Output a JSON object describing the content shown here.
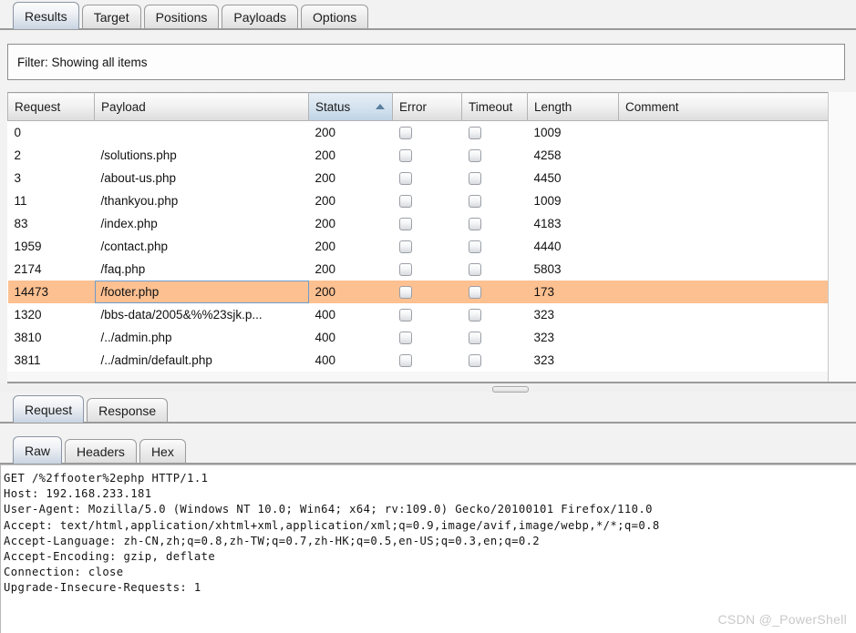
{
  "main_tabs": [
    {
      "label": "Results",
      "active": true
    },
    {
      "label": "Target",
      "active": false
    },
    {
      "label": "Positions",
      "active": false
    },
    {
      "label": "Payloads",
      "active": false
    },
    {
      "label": "Options",
      "active": false
    }
  ],
  "filter": {
    "text": "Filter: Showing all items"
  },
  "results_table": {
    "columns": [
      {
        "label": "Request",
        "sorted": false
      },
      {
        "label": "Payload",
        "sorted": false
      },
      {
        "label": "Status",
        "sorted": true,
        "sort_direction": "ascending"
      },
      {
        "label": "Error",
        "sorted": false
      },
      {
        "label": "Timeout",
        "sorted": false
      },
      {
        "label": "Length",
        "sorted": false
      },
      {
        "label": "Comment",
        "sorted": false
      }
    ],
    "rows": [
      {
        "request": "0",
        "payload": "",
        "status": "200",
        "error": false,
        "timeout": false,
        "length": "1009",
        "comment": "",
        "selected": false
      },
      {
        "request": "2",
        "payload": "/solutions.php",
        "status": "200",
        "error": false,
        "timeout": false,
        "length": "4258",
        "comment": "",
        "selected": false
      },
      {
        "request": "3",
        "payload": "/about-us.php",
        "status": "200",
        "error": false,
        "timeout": false,
        "length": "4450",
        "comment": "",
        "selected": false
      },
      {
        "request": "11",
        "payload": "/thankyou.php",
        "status": "200",
        "error": false,
        "timeout": false,
        "length": "1009",
        "comment": "",
        "selected": false
      },
      {
        "request": "83",
        "payload": "/index.php",
        "status": "200",
        "error": false,
        "timeout": false,
        "length": "4183",
        "comment": "",
        "selected": false
      },
      {
        "request": "1959",
        "payload": "/contact.php",
        "status": "200",
        "error": false,
        "timeout": false,
        "length": "4440",
        "comment": "",
        "selected": false
      },
      {
        "request": "2174",
        "payload": "/faq.php",
        "status": "200",
        "error": false,
        "timeout": false,
        "length": "5803",
        "comment": "",
        "selected": false
      },
      {
        "request": "14473",
        "payload": "/footer.php",
        "status": "200",
        "error": false,
        "timeout": false,
        "length": "173",
        "comment": "",
        "selected": true
      },
      {
        "request": "1320",
        "payload": "/bbs-data/2005&%%23sjk.p...",
        "status": "400",
        "error": false,
        "timeout": false,
        "length": "323",
        "comment": "",
        "selected": false
      },
      {
        "request": "3810",
        "payload": "/../admin.php",
        "status": "400",
        "error": false,
        "timeout": false,
        "length": "323",
        "comment": "",
        "selected": false
      },
      {
        "request": "3811",
        "payload": "/../admin/default.php",
        "status": "400",
        "error": false,
        "timeout": false,
        "length": "323",
        "comment": "",
        "selected": false
      }
    ]
  },
  "message_tabs": [
    {
      "label": "Request",
      "active": true
    },
    {
      "label": "Response",
      "active": false
    }
  ],
  "view_tabs": [
    {
      "label": "Raw",
      "active": true
    },
    {
      "label": "Headers",
      "active": false
    },
    {
      "label": "Hex",
      "active": false
    }
  ],
  "raw_request": {
    "lines": [
      "GET /%2ffooter%2ephp HTTP/1.1",
      "Host: 192.168.233.181",
      "User-Agent: Mozilla/5.0 (Windows NT 10.0; Win64; x64; rv:109.0) Gecko/20100101 Firefox/110.0",
      "Accept: text/html,application/xhtml+xml,application/xml;q=0.9,image/avif,image/webp,*/*;q=0.8",
      "Accept-Language: zh-CN,zh;q=0.8,zh-TW;q=0.7,zh-HK;q=0.5,en-US;q=0.3,en;q=0.2",
      "Accept-Encoding: gzip, deflate",
      "Connection: close",
      "Upgrade-Insecure-Requests: 1"
    ]
  },
  "watermark": {
    "text": "CSDN @_PowerShell"
  },
  "colors": {
    "selection": "#fcc091",
    "sorted_header": "#bed3e4",
    "focus_border": "#6f9ccd",
    "watermark": "#c9c9c9"
  }
}
